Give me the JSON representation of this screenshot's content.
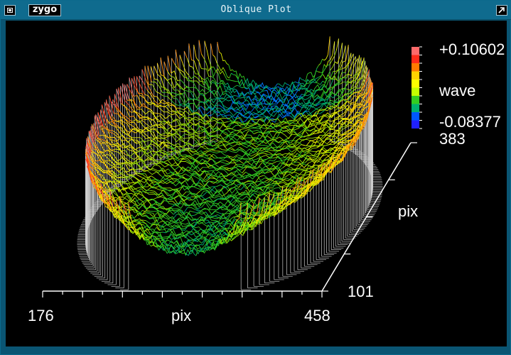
{
  "window": {
    "title": "Oblique Plot",
    "logo_text": "zygo",
    "close_icon": "close-box-icon",
    "maximize_icon": "maximize-arrow-icon"
  },
  "plot": {
    "x_min_label": "176",
    "x_max_label": "458",
    "x_axis_label": "pix",
    "y_axis_label": "pix",
    "y_min_label": "101",
    "y_max_label": "383",
    "colorbar": {
      "max_label": "+0.10602",
      "unit_label": "wave",
      "min_label": "-0.08377",
      "colors": [
        "#ff6a6a",
        "#ff2b1a",
        "#ff7a00",
        "#ffd200",
        "#ffff00",
        "#c4ff00",
        "#33cc22",
        "#00b070",
        "#0057ff",
        "#2020ff"
      ]
    },
    "colors": {
      "background": "#000000",
      "frame": "#0a5573",
      "axis": "#ffffff",
      "baseline_lines": "#cfcfcf"
    }
  }
}
